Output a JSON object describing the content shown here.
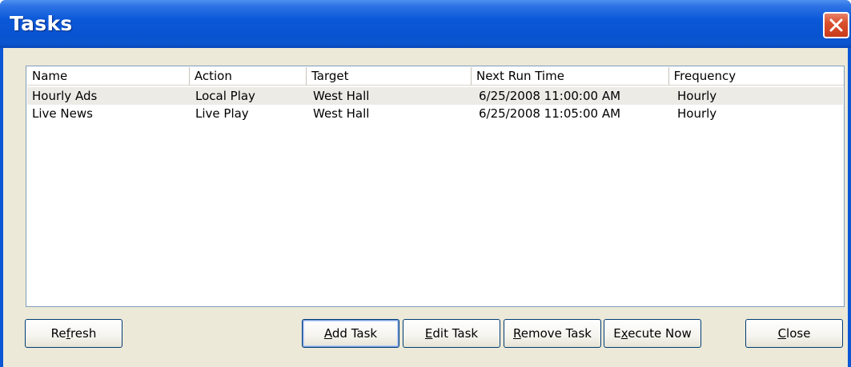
{
  "window": {
    "title": "Tasks",
    "close_icon": "close-icon"
  },
  "list": {
    "columns": [
      "Name",
      "Action",
      "Target",
      "Next Run Time",
      "Frequency"
    ],
    "rows": [
      {
        "name": "Hourly Ads",
        "action": "Local Play",
        "target": "West Hall",
        "next_run_time": "6/25/2008 11:00:00 AM",
        "frequency": "Hourly",
        "selected": true
      },
      {
        "name": "Live News",
        "action": "Live Play",
        "target": "West Hall",
        "next_run_time": "6/25/2008 11:05:00 AM",
        "frequency": "Hourly",
        "selected": false
      }
    ]
  },
  "buttons": {
    "refresh": {
      "pre": "Re",
      "mnemonic": "f",
      "post": "resh"
    },
    "add_task": {
      "pre": "",
      "mnemonic": "A",
      "post": "dd Task"
    },
    "edit_task": {
      "pre": "",
      "mnemonic": "E",
      "post": "dit Task"
    },
    "remove_task": {
      "pre": "",
      "mnemonic": "R",
      "post": "emove Task"
    },
    "execute_now": {
      "pre": "E",
      "mnemonic": "x",
      "post": "ecute Now"
    },
    "close": {
      "pre": "",
      "mnemonic": "C",
      "post": "lose"
    }
  },
  "colors": {
    "titlebar": "#0b58d8",
    "dialog_face": "#ece9d8",
    "close_button": "#d9502d",
    "selected_row": "#ecebe6"
  }
}
